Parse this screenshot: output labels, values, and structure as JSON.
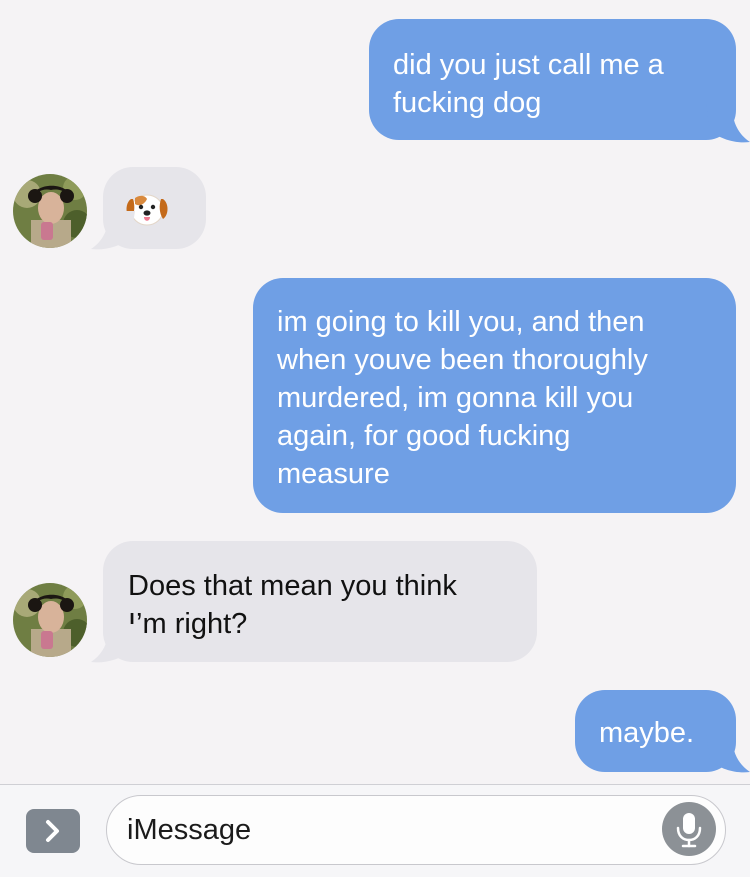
{
  "messages": [
    {
      "direction": "outgoing",
      "text_lines": [
        "did you just call me a",
        "fucking dog"
      ]
    },
    {
      "direction": "incoming",
      "text": "🐶",
      "emoji": "puppy-face-emoji"
    },
    {
      "direction": "outgoing",
      "text_lines": [
        "im going to kill you, and then",
        "when youve been thoroughly",
        "murdered, im gonna kill you",
        "again, for good fucking",
        "measure"
      ]
    },
    {
      "direction": "incoming",
      "text_lines": [
        "Does that mean you think",
        "I’m right?"
      ]
    },
    {
      "direction": "outgoing",
      "text_lines": [
        "maybe."
      ]
    }
  ],
  "input_bar": {
    "placeholder": "iMessage",
    "expand_icon": "chevron-right-icon",
    "mic_icon": "microphone-icon"
  },
  "colors": {
    "background": "#f5f3f5",
    "outgoing_bubble": "#6f9fe5",
    "incoming_bubble": "#e6e5ea",
    "outgoing_text": "#ffffff",
    "incoming_text": "#111111"
  }
}
